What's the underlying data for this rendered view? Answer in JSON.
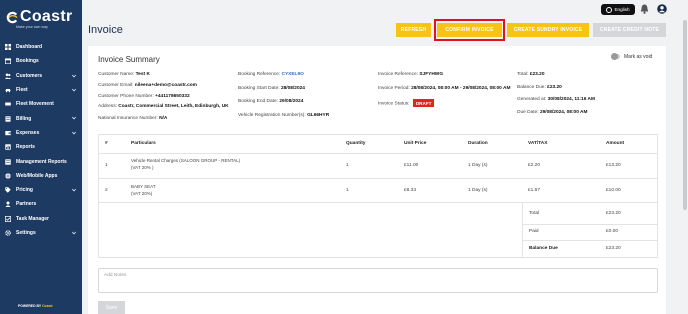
{
  "brand": {
    "name": "Coastr",
    "tagline": "Make your own way",
    "powered_prefix": "POWERED BY",
    "powered_brand": "Coastr"
  },
  "sidebar": {
    "items": [
      {
        "label": "Dashboard",
        "icon": "grid-icon",
        "expandable": false
      },
      {
        "label": "Bookings",
        "icon": "calendar-icon",
        "expandable": false
      },
      {
        "label": "Customers",
        "icon": "users-icon",
        "expandable": true
      },
      {
        "label": "Fleet",
        "icon": "car-icon",
        "expandable": true
      },
      {
        "label": "Fleet Movement",
        "icon": "arrows-icon",
        "expandable": false
      },
      {
        "label": "Billing",
        "icon": "billing-icon",
        "expandable": true
      },
      {
        "label": "Expenses",
        "icon": "wallet-icon",
        "expandable": true
      },
      {
        "label": "Reports",
        "icon": "chart-icon",
        "expandable": false
      },
      {
        "label": "Management Reports",
        "icon": "report-icon",
        "expandable": false
      },
      {
        "label": "Web/Mobile Apps",
        "icon": "globe-icon",
        "expandable": false
      },
      {
        "label": "Pricing",
        "icon": "tag-icon",
        "expandable": true
      },
      {
        "label": "Partners",
        "icon": "partner-icon",
        "expandable": false
      },
      {
        "label": "Task Manager",
        "icon": "tasks-icon",
        "expandable": false
      },
      {
        "label": "Settings",
        "icon": "gear-icon",
        "expandable": true
      }
    ]
  },
  "topbar": {
    "language": "English"
  },
  "header": {
    "title": "Invoice",
    "buttons": {
      "refresh": "REFRESH",
      "confirm": "CONFIRM INVOICE",
      "sundry": "CREATE SUNDRY INVOICE",
      "credit": "CREATE CREDIT NOTE"
    }
  },
  "summary": {
    "title": "Invoice Summary",
    "void_label": "Mark as void",
    "customer_name_label": "Customer Name:",
    "customer_name": "Test K",
    "customer_email_label": "Customer Email:",
    "customer_email": "nileena+demo@coastr.com",
    "customer_phone_label": "Customer Phone Number:",
    "customer_phone": "+441178650332",
    "address_label": "Address:",
    "address": "Coastr, Commercial Street, Leith, Edinburgh, UK",
    "ni_label": "National Insurance Number:",
    "ni": "N/A",
    "booking_ref_label": "Booking Reference:",
    "booking_ref": "CYXEL9O",
    "booking_start_label": "Booking Start Date:",
    "booking_start": "28/08/2024",
    "booking_end_label": "Booking End Date:",
    "booking_end": "29/08/2024",
    "vrn_label": "Vehicle Registration Number(s):",
    "vrn": "GL66HYR",
    "invoice_ref_label": "Invoice Reference:",
    "invoice_ref": "SJFYHWG",
    "invoice_period_label": "Invoice Period:",
    "invoice_period": "28/08/2024, 08:00 AM - 29/08/2024, 08:00 AM",
    "invoice_status_label": "Invoice Status:",
    "invoice_status": "DRAFT",
    "total_label": "Total:",
    "total": "£23.20",
    "balance_label": "Balance Due:",
    "balance": "£23.20",
    "generated_label": "Generated at:",
    "generated": "30/08/2024, 11:16 AM",
    "due_label": "Due Date:",
    "due": "29/08/2024, 08:00 AM"
  },
  "table": {
    "headers": [
      "#",
      "Particulars",
      "Quantity",
      "Unit Price",
      "Duration",
      "VAT/TAX",
      "Amount"
    ],
    "rows": [
      {
        "num": "1",
        "particulars": "Vehicle Rental Charges (SALOON GROUP - RENTAL)",
        "vat_note": "(VAT 20% )",
        "qty": "1",
        "unit": "£11.00",
        "duration": "1 Day (s)",
        "vat": "£2.20",
        "amount": "£13.20"
      },
      {
        "num": "2",
        "particulars": "BABY SEAT",
        "vat_note": "(VAT 20%)",
        "qty": "1",
        "unit": "£8.33",
        "duration": "1 Day (s)",
        "vat": "£1.67",
        "amount": "£10.00"
      }
    ],
    "totals": [
      {
        "label": "Total",
        "value": "£23.20"
      },
      {
        "label": "Paid",
        "value": "£0.00"
      },
      {
        "label": "Balance Due",
        "value": "£23.20"
      }
    ]
  },
  "notes": {
    "placeholder": "Add Notes"
  },
  "save_label": "Save"
}
